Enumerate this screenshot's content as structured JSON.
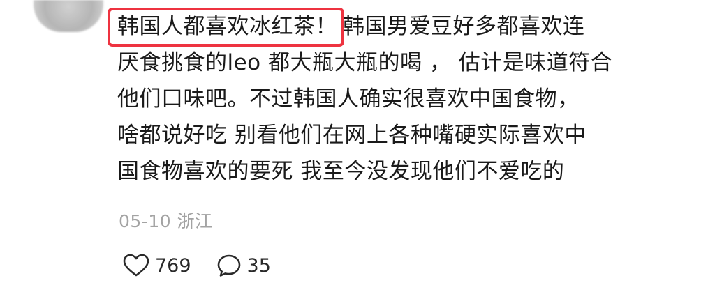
{
  "comment": {
    "highlighted_text": "韩国人都喜欢冰红茶！",
    "line1_rest": "韩国男爱豆好多都喜欢连",
    "line2": "厌食挑食的leo 都大瓶大瓶的喝 ， 估计是味道符合",
    "line3": "他们口味吧。不过韩国人确实很喜欢中国食物，",
    "line4": "啥都说好吃 别看他们在网上各种嘴硬实际喜欢中",
    "line5": "国食物喜欢的要死 我至今没发现他们不爱吃的",
    "date": "05-10",
    "location": "浙江"
  },
  "actions": {
    "like_icon": "heart-icon",
    "like_count": "769",
    "reply_icon": "comment-bubble-icon",
    "reply_count": "35"
  },
  "colors": {
    "highlight_border": "#ee3340",
    "text": "#1a1a1a",
    "meta": "#a3a3a3"
  }
}
